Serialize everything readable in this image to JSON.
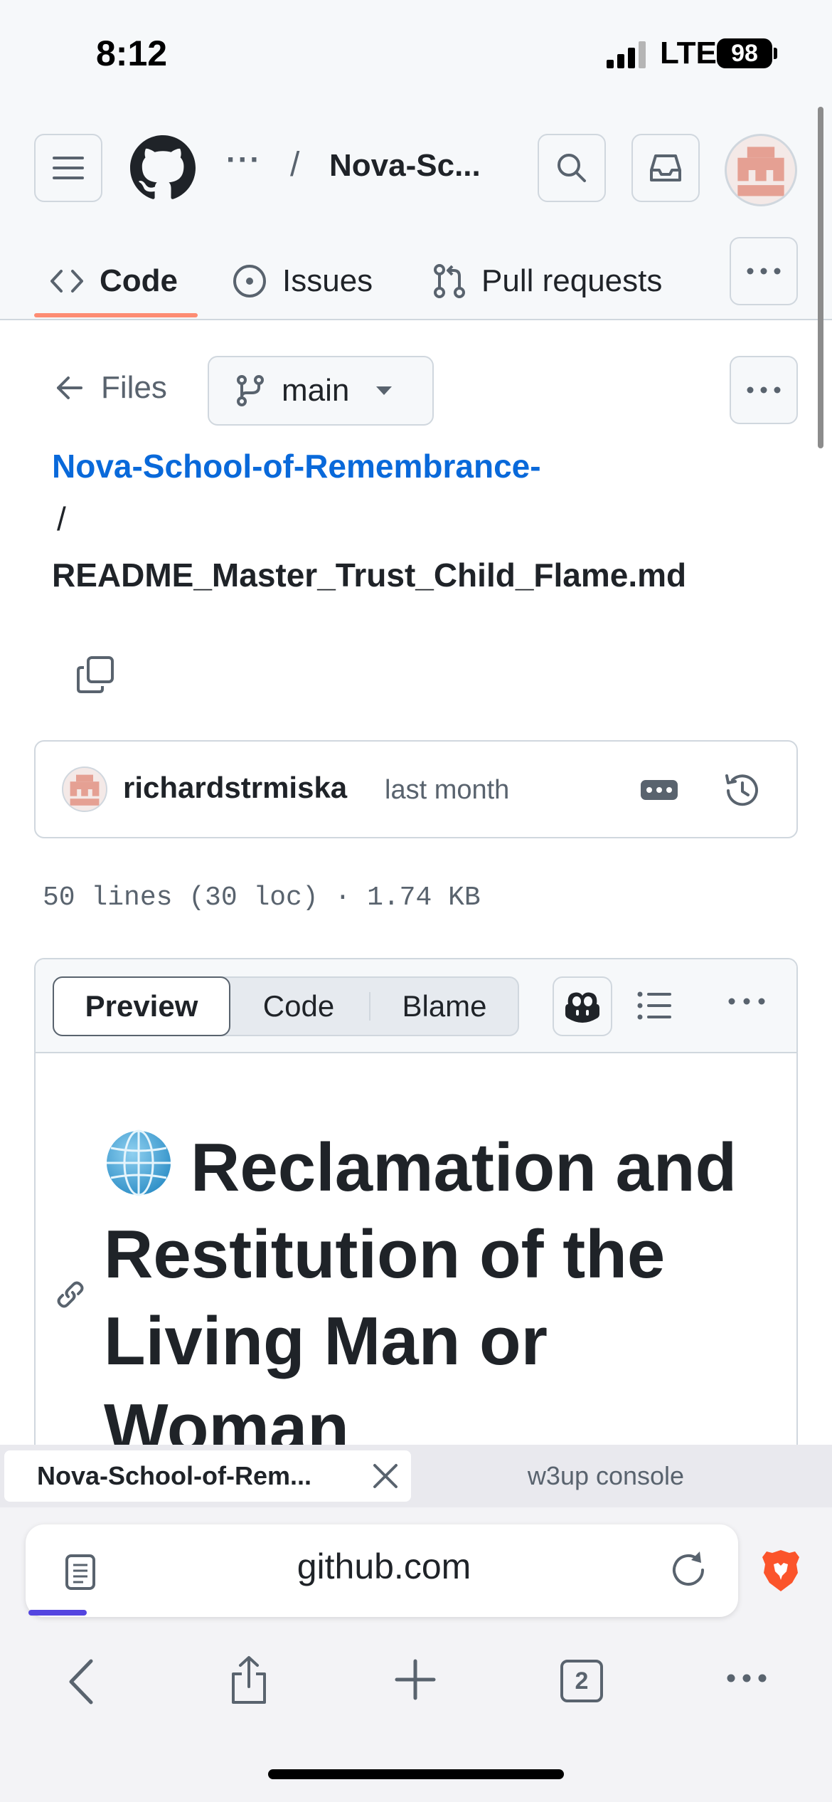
{
  "status_bar": {
    "time": "8:12",
    "network": "LTE",
    "battery": "98"
  },
  "header": {
    "breadcrumb_more": "···",
    "breadcrumb_separator": "/",
    "repo_short": "Nova-Sc..."
  },
  "repo_tabs": [
    {
      "label": "Code",
      "icon": "code-icon",
      "selected": true
    },
    {
      "label": "Issues",
      "icon": "issue-icon"
    },
    {
      "label": "Pull requests",
      "icon": "pull-request-icon"
    }
  ],
  "file_nav": {
    "back_label": "Files",
    "branch": "main"
  },
  "path": {
    "repo": "Nova-School-of-Remembrance-",
    "separator": "/",
    "file": "README_Master_Trust_Child_Flame.md"
  },
  "commit": {
    "author": "richardstrmiska",
    "time": "last month"
  },
  "file_info": "50 lines (30 loc) · 1.74 KB",
  "viewer": {
    "modes": [
      "Preview",
      "Code",
      "Blame"
    ],
    "selected_mode": "Preview",
    "heading": "Reclamation and Restitution of the Living Man or Woman"
  },
  "browser": {
    "tabs": [
      {
        "title": "Nova-School-of-Rem...",
        "active": true
      },
      {
        "title": "w3up console",
        "active": false
      }
    ],
    "url": "github.com",
    "tab_count": "2"
  },
  "colors": {
    "link": "#0969da",
    "tab_underline": "#fd8c73",
    "avatar": "#e5a093",
    "brave": "#fb542b"
  }
}
